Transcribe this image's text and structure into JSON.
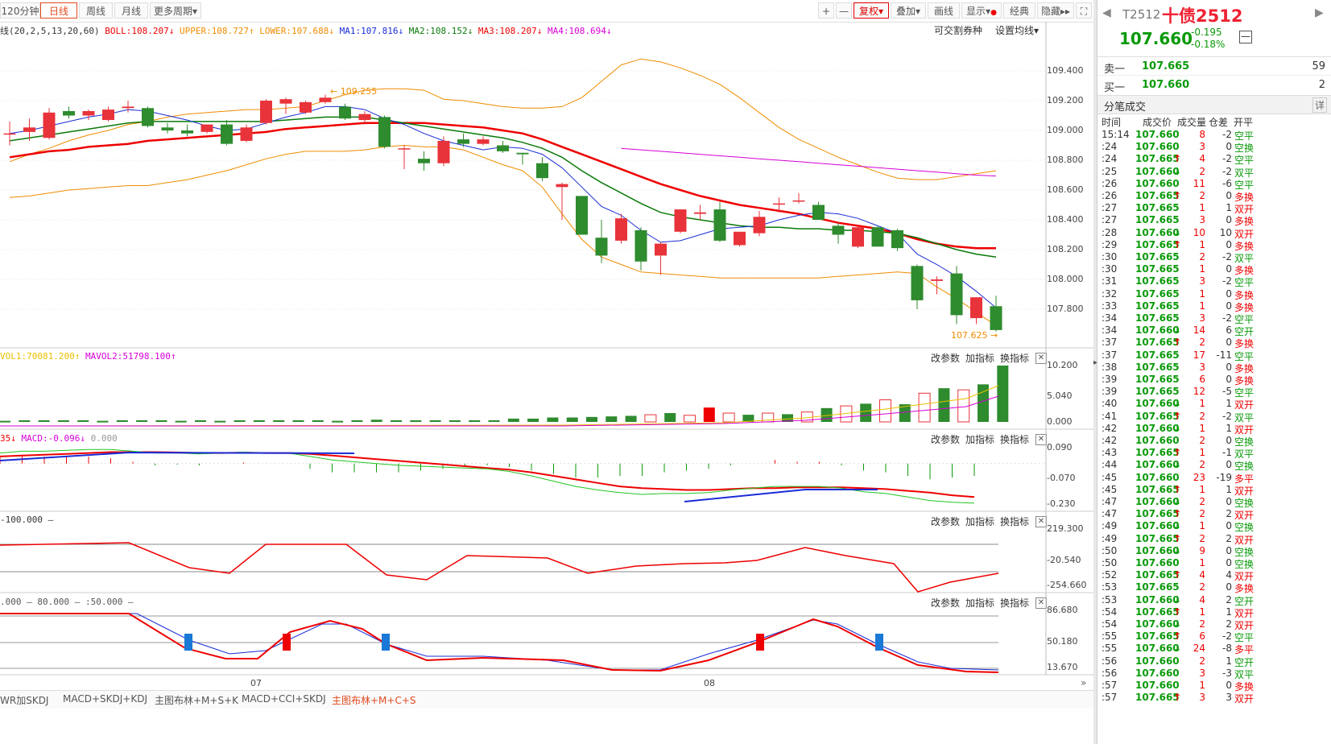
{
  "toolbar": {
    "periods": [
      "120分钟",
      "日线",
      "周线",
      "月线",
      "更多周期"
    ],
    "right_buttons": [
      "+",
      "—",
      "复权",
      "叠加",
      "画线",
      "显示",
      "经典",
      "隐藏"
    ]
  },
  "legend": {
    "boll_prefix": "线(20,2,5,13,20,60)",
    "boll": "BOLL:108.207",
    "upper": "UPPER:108.727",
    "lower": "LOWER:107.688",
    "ma1": "MA1:107.816",
    "ma2": "MA2:108.152",
    "ma3": "MA3:108.207",
    "ma4": "MA4:108.694",
    "right_link1": "可交割券种",
    "right_link2": "设置均线"
  },
  "panel_links": {
    "change": "改参数",
    "add": "加指标",
    "switch": "换指标"
  },
  "vol_legend": {
    "vol1": "VOL1:70081.200",
    "mavol2": "MAVOL2:51798.100"
  },
  "macd_legend": {
    "prefix": "35",
    "macd": "MACD:-0.096",
    "zero": "0.000"
  },
  "cci_legend": "-100.000",
  "kdj_legend": {
    "a": ".000",
    "b": "80.000",
    "c": ":50.000"
  },
  "annotations": {
    "high": "109.255",
    "low": "107.625"
  },
  "axes": {
    "main": [
      "109.400",
      "109.200",
      "109.000",
      "108.800",
      "108.600",
      "108.400",
      "108.200",
      "108.000",
      "107.800"
    ],
    "vol": [
      "10.200",
      "5.040",
      "0.000"
    ],
    "macd": [
      "0.090",
      "-0.070",
      "-0.230"
    ],
    "cci": [
      "219.300",
      "-20.540",
      "-254.660"
    ],
    "kdj": [
      "86.680",
      "50.180",
      "13.670"
    ],
    "x_labels": [
      "07",
      "08"
    ]
  },
  "bottom_tabs": [
    "WR加SKDJ",
    "MACD+SKDJ+KDJ",
    "主图布林+M+S+K",
    "MACD+CCI+SKDJ",
    "主图布林+M+C+S"
  ],
  "quote": {
    "code": "T2512",
    "name": "十债2512",
    "price": "107.660",
    "change": "-0.195",
    "change_pct": "-0.18%",
    "sell_label": "卖一",
    "sell_price": "107.665",
    "sell_qty": "59",
    "buy_label": "买一",
    "buy_price": "107.660",
    "buy_qty": "2",
    "ticks_title": "分笔成交",
    "detail": "详",
    "headers": [
      "时间",
      "成交价",
      "成交量",
      "仓差",
      "开平"
    ]
  },
  "ticks": [
    [
      "15:14",
      "107.660",
      "",
      "8",
      "-2",
      "空平"
    ],
    [
      ":24",
      "107.660",
      "",
      "3",
      "0",
      "空换"
    ],
    [
      ":24",
      "107.665",
      "up",
      "4",
      "-2",
      "空平"
    ],
    [
      ":25",
      "107.660",
      "down",
      "2",
      "-2",
      "双平"
    ],
    [
      ":26",
      "107.660",
      "",
      "11",
      "-6",
      "空平"
    ],
    [
      ":26",
      "107.665",
      "up",
      "2",
      "0",
      "多换"
    ],
    [
      ":27",
      "107.665",
      "",
      "1",
      "1",
      "双开"
    ],
    [
      ":27",
      "107.665",
      "",
      "3",
      "0",
      "多换"
    ],
    [
      ":28",
      "107.660",
      "down",
      "10",
      "10",
      "双开"
    ],
    [
      ":29",
      "107.665",
      "up",
      "1",
      "0",
      "多换"
    ],
    [
      ":30",
      "107.665",
      "",
      "2",
      "-2",
      "双平"
    ],
    [
      ":30",
      "107.665",
      "",
      "1",
      "0",
      "多换"
    ],
    [
      ":31",
      "107.665",
      "",
      "3",
      "-2",
      "空平"
    ],
    [
      ":32",
      "107.665",
      "",
      "1",
      "0",
      "多换"
    ],
    [
      ":33",
      "107.665",
      "",
      "1",
      "0",
      "多换"
    ],
    [
      ":34",
      "107.665",
      "",
      "3",
      "-2",
      "空平"
    ],
    [
      ":34",
      "107.660",
      "down",
      "14",
      "6",
      "空开"
    ],
    [
      ":37",
      "107.665",
      "up",
      "2",
      "0",
      "多换"
    ],
    [
      ":37",
      "107.665",
      "",
      "17",
      "-11",
      "空平"
    ],
    [
      ":38",
      "107.665",
      "",
      "3",
      "0",
      "多换"
    ],
    [
      ":39",
      "107.665",
      "",
      "6",
      "0",
      "多换"
    ],
    [
      ":39",
      "107.665",
      "",
      "12",
      "-5",
      "空平"
    ],
    [
      ":40",
      "107.660",
      "down",
      "1",
      "1",
      "双开"
    ],
    [
      ":41",
      "107.665",
      "up",
      "2",
      "-2",
      "双平"
    ],
    [
      ":42",
      "107.660",
      "down",
      "1",
      "1",
      "双开"
    ],
    [
      ":42",
      "107.660",
      "",
      "2",
      "0",
      "空换"
    ],
    [
      ":43",
      "107.665",
      "up",
      "1",
      "-1",
      "双平"
    ],
    [
      ":44",
      "107.660",
      "down",
      "2",
      "0",
      "空换"
    ],
    [
      ":45",
      "107.660",
      "",
      "23",
      "-19",
      "多平"
    ],
    [
      ":45",
      "107.665",
      "up",
      "1",
      "1",
      "双开"
    ],
    [
      ":47",
      "107.660",
      "down",
      "2",
      "0",
      "空换"
    ],
    [
      ":47",
      "107.665",
      "up",
      "2",
      "2",
      "双开"
    ],
    [
      ":49",
      "107.660",
      "down",
      "1",
      "0",
      "空换"
    ],
    [
      ":49",
      "107.665",
      "up",
      "2",
      "2",
      "双开"
    ],
    [
      ":50",
      "107.660",
      "down",
      "9",
      "0",
      "空换"
    ],
    [
      ":50",
      "107.660",
      "",
      "1",
      "0",
      "空换"
    ],
    [
      ":52",
      "107.665",
      "up",
      "4",
      "4",
      "双开"
    ],
    [
      ":53",
      "107.665",
      "",
      "2",
      "0",
      "多换"
    ],
    [
      ":53",
      "107.660",
      "down",
      "4",
      "2",
      "空开"
    ],
    [
      ":54",
      "107.665",
      "up",
      "1",
      "1",
      "双开"
    ],
    [
      ":54",
      "107.660",
      "down",
      "2",
      "2",
      "双开"
    ],
    [
      ":55",
      "107.665",
      "up",
      "6",
      "-2",
      "空平"
    ],
    [
      ":55",
      "107.660",
      "down",
      "24",
      "-8",
      "多平"
    ],
    [
      ":56",
      "107.660",
      "",
      "2",
      "1",
      "空开"
    ],
    [
      ":56",
      "107.660",
      "",
      "3",
      "-3",
      "双平"
    ],
    [
      ":57",
      "107.660",
      "",
      "1",
      "0",
      "多换"
    ],
    [
      ":57",
      "107.665",
      "up",
      "3",
      "3",
      "双开"
    ]
  ],
  "chart_data": [
    {
      "type": "candlestick",
      "title": "",
      "ylim": [
        107.56,
        109.48
      ],
      "candles": [
        {
          "o": 108.98,
          "h": 109.06,
          "l": 108.9,
          "c": 108.98
        },
        {
          "o": 108.99,
          "h": 109.08,
          "l": 108.93,
          "c": 109.02
        },
        {
          "o": 108.95,
          "h": 109.15,
          "l": 108.94,
          "c": 109.12
        },
        {
          "o": 109.13,
          "h": 109.16,
          "l": 109.08,
          "c": 109.1
        },
        {
          "o": 109.1,
          "h": 109.14,
          "l": 109.07,
          "c": 109.13
        },
        {
          "o": 109.07,
          "h": 109.16,
          "l": 109.06,
          "c": 109.14
        },
        {
          "o": 109.15,
          "h": 109.2,
          "l": 109.12,
          "c": 109.16
        },
        {
          "o": 109.15,
          "h": 109.16,
          "l": 109.02,
          "c": 109.03
        },
        {
          "o": 109.02,
          "h": 109.05,
          "l": 108.98,
          "c": 109.0
        },
        {
          "o": 109.0,
          "h": 109.04,
          "l": 108.96,
          "c": 108.98
        },
        {
          "o": 108.99,
          "h": 109.04,
          "l": 108.98,
          "c": 109.04
        },
        {
          "o": 109.04,
          "h": 109.07,
          "l": 108.9,
          "c": 108.91
        },
        {
          "o": 108.93,
          "h": 109.04,
          "l": 108.92,
          "c": 109.02
        },
        {
          "o": 109.05,
          "h": 109.21,
          "l": 109.04,
          "c": 109.2
        },
        {
          "o": 109.18,
          "h": 109.22,
          "l": 109.11,
          "c": 109.21
        },
        {
          "o": 109.12,
          "h": 109.2,
          "l": 109.11,
          "c": 109.19
        },
        {
          "o": 109.19,
          "h": 109.24,
          "l": 109.18,
          "c": 109.22
        },
        {
          "o": 109.16,
          "h": 109.18,
          "l": 109.07,
          "c": 109.08
        },
        {
          "o": 109.07,
          "h": 109.13,
          "l": 109.04,
          "c": 109.11
        },
        {
          "o": 109.09,
          "h": 109.1,
          "l": 108.88,
          "c": 108.89
        },
        {
          "o": 108.88,
          "h": 108.9,
          "l": 108.74,
          "c": 108.88
        },
        {
          "o": 108.81,
          "h": 108.86,
          "l": 108.73,
          "c": 108.78
        },
        {
          "o": 108.78,
          "h": 108.96,
          "l": 108.76,
          "c": 108.93
        },
        {
          "o": 108.94,
          "h": 108.98,
          "l": 108.89,
          "c": 108.91
        },
        {
          "o": 108.91,
          "h": 108.96,
          "l": 108.9,
          "c": 108.94
        },
        {
          "o": 108.9,
          "h": 108.93,
          "l": 108.85,
          "c": 108.86
        },
        {
          "o": 108.85,
          "h": 108.84,
          "l": 108.77,
          "c": 108.84
        },
        {
          "o": 108.78,
          "h": 108.82,
          "l": 108.66,
          "c": 108.68
        },
        {
          "o": 108.62,
          "h": 108.65,
          "l": 108.4,
          "c": 108.64
        },
        {
          "o": 108.56,
          "h": 108.56,
          "l": 108.3,
          "c": 108.3
        },
        {
          "o": 108.28,
          "h": 108.4,
          "l": 108.11,
          "c": 108.16
        },
        {
          "o": 108.26,
          "h": 108.44,
          "l": 108.24,
          "c": 108.41
        },
        {
          "o": 108.33,
          "h": 108.35,
          "l": 108.06,
          "c": 108.12
        },
        {
          "o": 108.16,
          "h": 108.25,
          "l": 108.03,
          "c": 108.24
        },
        {
          "o": 108.32,
          "h": 108.47,
          "l": 108.31,
          "c": 108.47
        },
        {
          "o": 108.44,
          "h": 108.5,
          "l": 108.4,
          "c": 108.45
        },
        {
          "o": 108.47,
          "h": 108.52,
          "l": 108.25,
          "c": 108.26
        },
        {
          "o": 108.23,
          "h": 108.32,
          "l": 108.22,
          "c": 108.32
        },
        {
          "o": 108.31,
          "h": 108.46,
          "l": 108.29,
          "c": 108.42
        },
        {
          "o": 108.51,
          "h": 108.55,
          "l": 108.45,
          "c": 108.51
        },
        {
          "o": 108.53,
          "h": 108.58,
          "l": 108.51,
          "c": 108.53
        },
        {
          "o": 108.5,
          "h": 108.52,
          "l": 108.4,
          "c": 108.4
        },
        {
          "o": 108.36,
          "h": 108.38,
          "l": 108.24,
          "c": 108.3
        },
        {
          "o": 108.22,
          "h": 108.36,
          "l": 108.21,
          "c": 108.35
        },
        {
          "o": 108.35,
          "h": 108.36,
          "l": 108.22,
          "c": 108.22
        },
        {
          "o": 108.33,
          "h": 108.34,
          "l": 108.19,
          "c": 108.21
        },
        {
          "o": 108.09,
          "h": 108.1,
          "l": 107.8,
          "c": 107.86
        },
        {
          "o": 107.99,
          "h": 108.02,
          "l": 107.9,
          "c": 108.0
        },
        {
          "o": 108.04,
          "h": 108.09,
          "l": 107.7,
          "c": 107.76
        },
        {
          "o": 107.74,
          "h": 107.88,
          "l": 107.7,
          "c": 107.88
        },
        {
          "o": 107.82,
          "h": 107.89,
          "l": 107.65,
          "c": 107.66
        }
      ],
      "ma1": [
        108.98,
        109.0,
        109.03,
        109.06,
        109.09,
        109.11,
        109.14,
        109.13,
        109.1,
        109.07,
        109.03,
        109.0,
        109.01,
        109.05,
        109.09,
        109.12,
        109.16,
        109.16,
        109.14,
        109.08,
        109.04,
        108.98,
        108.93,
        108.9,
        108.87,
        108.89,
        108.88,
        108.84,
        108.75,
        108.62,
        108.49,
        108.43,
        108.33,
        108.25,
        108.26,
        108.3,
        108.34,
        108.35,
        108.36,
        108.4,
        108.43,
        108.45,
        108.44,
        108.41,
        108.36,
        108.31,
        108.17,
        108.1,
        108.02,
        107.92,
        107.81
      ],
      "ma2": [
        108.93,
        108.95,
        108.97,
        108.99,
        109.01,
        109.03,
        109.05,
        109.06,
        109.06,
        109.06,
        109.06,
        109.06,
        109.06,
        109.06,
        109.07,
        109.08,
        109.09,
        109.09,
        109.09,
        109.07,
        109.05,
        109.03,
        109.01,
        108.99,
        108.97,
        108.95,
        108.92,
        108.88,
        108.82,
        108.73,
        108.65,
        108.58,
        108.51,
        108.45,
        108.42,
        108.4,
        108.38,
        108.36,
        108.35,
        108.35,
        108.34,
        108.34,
        108.33,
        108.33,
        108.32,
        108.31,
        108.28,
        108.24,
        108.2,
        108.17,
        108.15
      ],
      "ma3": [
        108.82,
        108.84,
        108.86,
        108.87,
        108.89,
        108.9,
        108.91,
        108.93,
        108.94,
        108.95,
        108.96,
        108.97,
        108.98,
        108.99,
        109.01,
        109.02,
        109.03,
        109.04,
        109.05,
        109.05,
        109.05,
        109.05,
        109.04,
        109.03,
        109.02,
        109.0,
        108.98,
        108.94,
        108.89,
        108.84,
        108.79,
        108.74,
        108.69,
        108.64,
        108.6,
        108.56,
        108.53,
        108.5,
        108.48,
        108.46,
        108.44,
        108.41,
        108.38,
        108.36,
        108.34,
        108.31,
        108.27,
        108.24,
        108.22,
        108.21,
        108.21
      ],
      "upper": [
        108.79,
        108.84,
        108.88,
        108.93,
        108.97,
        109.0,
        109.04,
        109.06,
        109.09,
        109.11,
        109.12,
        109.13,
        109.14,
        109.14,
        109.15,
        109.16,
        109.2,
        109.24,
        109.27,
        109.28,
        109.28,
        109.27,
        109.21,
        109.2,
        109.18,
        109.16,
        109.15,
        109.15,
        109.16,
        109.22,
        109.33,
        109.44,
        109.48,
        109.46,
        109.42,
        109.37,
        109.31,
        109.22,
        109.12,
        109.02,
        108.94,
        108.88,
        108.82,
        108.77,
        108.72,
        108.68,
        108.67,
        108.67,
        108.69,
        108.71,
        108.73
      ],
      "lower": [
        108.55,
        108.56,
        108.58,
        108.6,
        108.61,
        108.62,
        108.63,
        108.63,
        108.65,
        108.67,
        108.7,
        108.73,
        108.77,
        108.81,
        108.84,
        108.86,
        108.86,
        108.86,
        108.87,
        108.89,
        108.9,
        108.89,
        108.89,
        108.87,
        108.82,
        108.77,
        108.73,
        108.62,
        108.44,
        108.27,
        108.15,
        108.1,
        108.05,
        108.04,
        108.03,
        108.02,
        108.01,
        108.01,
        108.01,
        108.01,
        108.01,
        108.01,
        108.02,
        108.03,
        108.04,
        108.05,
        108.04,
        107.95,
        107.87,
        107.78,
        107.69
      ],
      "ma4": [
        null,
        null,
        null,
        null,
        null,
        null,
        null,
        null,
        null,
        null,
        null,
        null,
        null,
        null,
        null,
        null,
        null,
        null,
        null,
        null,
        null,
        null,
        null,
        null,
        null,
        null,
        null,
        null,
        null,
        null,
        null,
        108.88,
        108.87,
        108.86,
        108.85,
        108.84,
        108.83,
        108.82,
        108.81,
        108.8,
        108.79,
        108.78,
        108.77,
        108.76,
        108.75,
        108.74,
        108.73,
        108.72,
        108.71,
        108.7,
        108.694
      ]
    },
    {
      "type": "bar",
      "ylim": [
        0,
        10.2
      ],
      "values": [
        0.2,
        0.3,
        0.3,
        0.3,
        0.3,
        0.2,
        0.3,
        0.3,
        0.3,
        0.2,
        0.3,
        0.2,
        0.3,
        0.3,
        0.3,
        0.3,
        0.3,
        0.2,
        0.3,
        0.4,
        0.3,
        0.3,
        0.3,
        0.3,
        0.3,
        0.3,
        0.6,
        0.6,
        0.8,
        0.8,
        0.9,
        1.0,
        1.1,
        1.3,
        1.6,
        1.2,
        2.6,
        1.6,
        1.3,
        1.6,
        1.4,
        1.8,
        2.5,
        2.9,
        3.3,
        4.0,
        3.2,
        5.2,
        6.1,
        5.8,
        6.8,
        10.2
      ]
    },
    {
      "type": "line",
      "ylim": [
        -0.23,
        0.09
      ],
      "dif": [
        0.06,
        0.07,
        0.07,
        0.075,
        0.08,
        0.08,
        0.07,
        0.06,
        0.06,
        0.055,
        0.06,
        0.065,
        0.06,
        0.06,
        0.04,
        0.02,
        0.01,
        0.0,
        -0.01,
        -0.015,
        -0.02,
        -0.025,
        -0.03,
        -0.045,
        -0.07,
        -0.1,
        -0.13,
        -0.15,
        -0.165,
        -0.175,
        -0.17,
        -0.17,
        -0.165,
        -0.15,
        -0.14,
        -0.13,
        -0.13,
        -0.13,
        -0.14,
        -0.16,
        -0.17,
        -0.19,
        -0.21,
        -0.22,
        -0.225
      ],
      "dea": [
        0.04,
        0.045,
        0.05,
        0.055,
        0.06,
        0.065,
        0.065,
        0.065,
        0.063,
        0.06,
        0.06,
        0.062,
        0.06,
        0.06,
        0.055,
        0.045,
        0.035,
        0.025,
        0.015,
        0.005,
        -0.005,
        -0.015,
        -0.025,
        -0.035,
        -0.05,
        -0.07,
        -0.09,
        -0.11,
        -0.13,
        -0.14,
        -0.145,
        -0.15,
        -0.15,
        -0.145,
        -0.14,
        -0.14,
        -0.135,
        -0.135,
        -0.135,
        -0.14,
        -0.145,
        -0.155,
        -0.165,
        -0.18,
        -0.19
      ]
    }
  ]
}
